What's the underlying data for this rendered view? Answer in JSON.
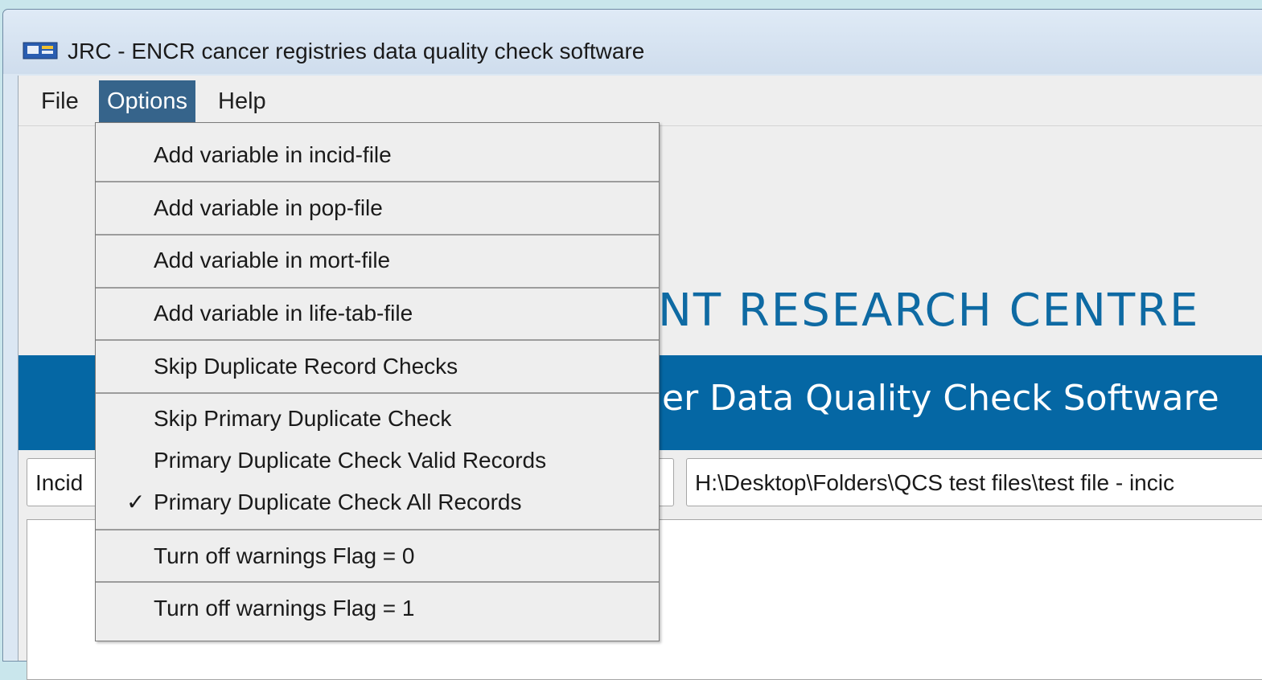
{
  "window": {
    "title": "JRC - ENCR cancer registries data quality check software"
  },
  "menubar": {
    "items": [
      {
        "label": "File"
      },
      {
        "label": "Options"
      },
      {
        "label": "Help"
      }
    ]
  },
  "banner": {
    "title_visible": "NT RESEARCH CENTRE",
    "subtitle_visible": "er Data Quality Check Software"
  },
  "file_type_combo": {
    "value": "Incid"
  },
  "path_field": {
    "value": "H:\\Desktop\\Folders\\QCS test files\\test file - incic"
  },
  "options_menu": {
    "items": [
      {
        "label": "Add variable in incid-file",
        "checked": false
      },
      {
        "label": "Add variable in pop-file",
        "checked": false
      },
      {
        "label": "Add variable in mort-file",
        "checked": false
      },
      {
        "label": "Add variable in life-tab-file",
        "checked": false
      },
      {
        "label": "Skip Duplicate Record Checks",
        "checked": false
      },
      {
        "label": "Skip Primary Duplicate Check",
        "checked": false
      },
      {
        "label": "Primary Duplicate Check Valid Records",
        "checked": false
      },
      {
        "label": "Primary Duplicate Check All Records",
        "checked": true
      },
      {
        "label": "Turn off warnings Flag = 0",
        "checked": false
      },
      {
        "label": "Turn off warnings Flag = 1",
        "checked": false
      }
    ],
    "check_glyph": "✓"
  },
  "colors": {
    "menu_highlight": "#36648b",
    "brand_blue": "#0567a4",
    "title_blue": "#0e6aa3"
  }
}
